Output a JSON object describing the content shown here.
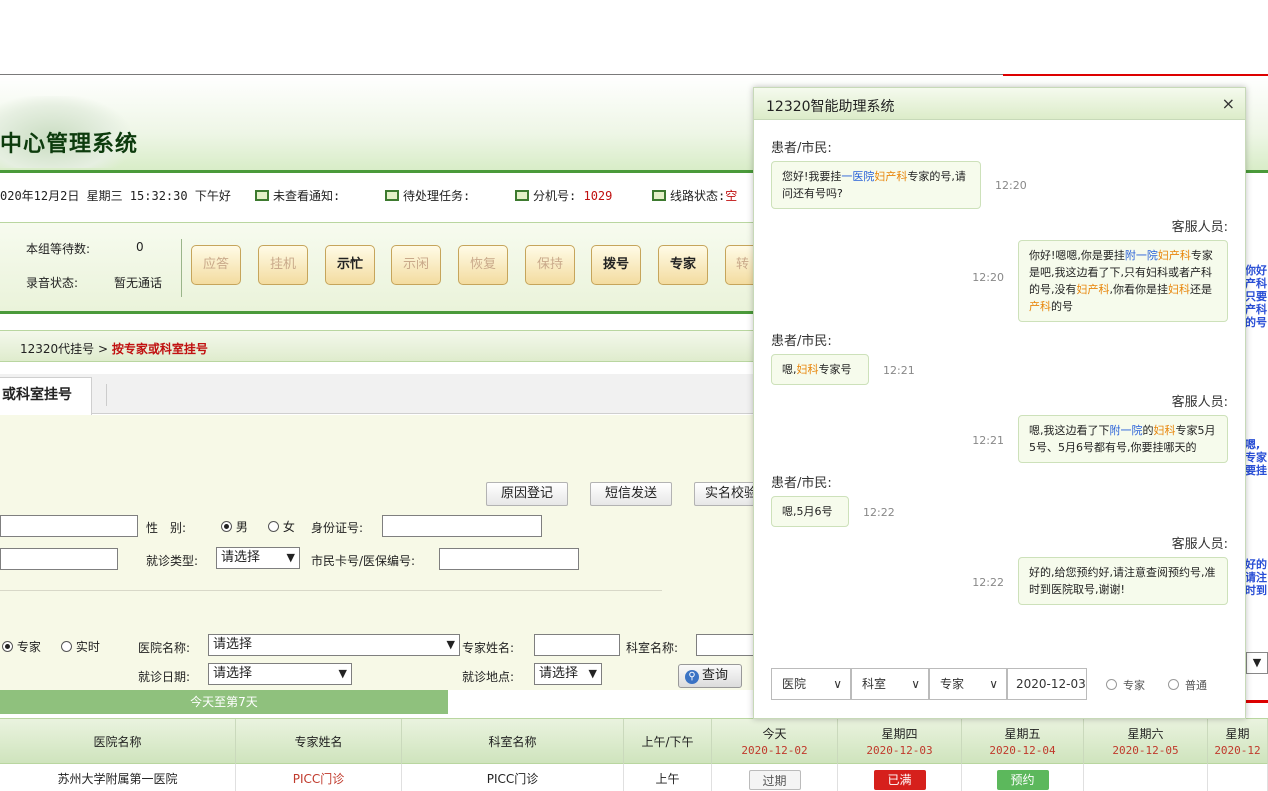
{
  "app": {
    "system_title": "中心管理系统"
  },
  "status_bar": {
    "datetime": "020年12月2日 星期三 15:32:30 下午好",
    "unread_notice": "未查看通知:",
    "pending_tasks": "待处理任务:",
    "extension_label": "分机号:",
    "extension_value": "1029",
    "line_status_label": "线路状态:",
    "line_status_value": "空"
  },
  "toolbar": {
    "queue_label": "本组等待数:",
    "queue_value": "0",
    "recording_label": "录音状态:",
    "recording_value": "暂无通话",
    "buttons": [
      {
        "label": "应答",
        "enabled": false
      },
      {
        "label": "挂机",
        "enabled": false
      },
      {
        "label": "示忙",
        "enabled": true
      },
      {
        "label": "示闲",
        "enabled": false
      },
      {
        "label": "恢复",
        "enabled": false
      },
      {
        "label": "保持",
        "enabled": false
      },
      {
        "label": "拨号",
        "enabled": true
      },
      {
        "label": "专家",
        "enabled": true
      },
      {
        "label": "转",
        "enabled": false
      }
    ]
  },
  "breadcrumb": {
    "parent": "12320代挂号",
    "separator": ">",
    "current": "按专家或科室挂号"
  },
  "tab": {
    "active_label": "或科室挂号"
  },
  "form": {
    "btn_reason": "原因登记",
    "btn_sms": "短信发送",
    "btn_realname": "实名校验",
    "gender_label": "性　别:",
    "gender_male": "男",
    "gender_female": "女",
    "id_label": "身份证号:",
    "visit_type_label": "就诊类型:",
    "visit_type_value": "请选择",
    "card_label": "市民卡号/医保编号:",
    "mode_expert": "专家",
    "mode_realtime": "实时",
    "hospital_label": "医院名称:",
    "hospital_value": "请选择",
    "expert_label": "专家姓名:",
    "dept_label": "科室名称:",
    "date_label": "就诊日期:",
    "date_value": "请选择",
    "place_label": "就诊地点:",
    "place_value": "请选择",
    "query_label": "查询",
    "range_label": "今天至第7天"
  },
  "table": {
    "headers": [
      {
        "l1": "医院名称",
        "l2": ""
      },
      {
        "l1": "专家姓名",
        "l2": ""
      },
      {
        "l1": "科室名称",
        "l2": ""
      },
      {
        "l1": "上午/下午",
        "l2": ""
      },
      {
        "l1": "今天",
        "l2": "2020-12-02"
      },
      {
        "l1": "星期四",
        "l2": "2020-12-03"
      },
      {
        "l1": "星期五",
        "l2": "2020-12-04"
      },
      {
        "l1": "星期六",
        "l2": "2020-12-05"
      },
      {
        "l1": "星期",
        "l2": "2020-12"
      }
    ],
    "row": {
      "hospital": "苏州大学附属第一医院",
      "expert": "PICC门诊",
      "dept": "PICC门诊",
      "period": "上午",
      "today": "过期",
      "thu": "已满",
      "fri": "预约"
    }
  },
  "right_fragments": {
    "block1": [
      "你好",
      "产科",
      "只要",
      "产科",
      "的号"
    ],
    "block2": [
      "嗯,",
      "专家",
      "要挂"
    ],
    "block3": [
      "好的",
      "请注",
      "时到"
    ]
  },
  "dialog": {
    "title": "12320智能助理系统",
    "close": "×",
    "messages": [
      {
        "sender": "患者/市民:",
        "side": "left",
        "time": "12:20",
        "parts": [
          [
            "您好!我要挂",
            ""
          ],
          [
            "一医院",
            "blue"
          ],
          [
            "妇产科",
            "orange"
          ],
          [
            "专家的号,请问还有号吗?",
            ""
          ]
        ]
      },
      {
        "sender": "客服人员:",
        "side": "right",
        "time": "12:20",
        "parts": [
          [
            "你好!嗯嗯,你是要挂",
            ""
          ],
          [
            "附一院",
            "blue"
          ],
          [
            "妇产科",
            "orange"
          ],
          [
            "专家是吧,我这边看了下,只有妇科或者产科的号,没有",
            ""
          ],
          [
            "妇产科",
            "orange"
          ],
          [
            ",你看你是挂",
            ""
          ],
          [
            "妇科",
            "orange"
          ],
          [
            "还是",
            ""
          ],
          [
            "产科",
            "orange"
          ],
          [
            "的号",
            ""
          ]
        ]
      },
      {
        "sender": "患者/市民:",
        "side": "left",
        "time": "12:21",
        "parts": [
          [
            "嗯,",
            ""
          ],
          [
            "妇科",
            "orange"
          ],
          [
            "专家号",
            ""
          ]
        ]
      },
      {
        "sender": "客服人员:",
        "side": "right",
        "time": "12:21",
        "parts": [
          [
            "嗯,我这边看了下",
            ""
          ],
          [
            "附一院",
            "blue"
          ],
          [
            "的",
            ""
          ],
          [
            "妇科",
            "orange"
          ],
          [
            "专家5月5号、5月6号都有号,你要挂哪天的",
            ""
          ]
        ]
      },
      {
        "sender": "患者/市民:",
        "side": "left",
        "time": "12:22",
        "parts": [
          [
            "嗯,5月6号",
            ""
          ]
        ]
      },
      {
        "sender": "客服人员:",
        "side": "right",
        "time": "12:22",
        "parts": [
          [
            "好的,给您预约好,请注意查阅预约号,准时到医院取号,谢谢!",
            ""
          ]
        ]
      }
    ],
    "footer": {
      "hospital": "医院",
      "dept": "科室",
      "expert": "专家",
      "date": "2020-12-03",
      "radio_expert": "专家",
      "radio_normal": "普通"
    }
  },
  "colors": {
    "accent_green": "#4a9a3a",
    "highlight_blue": "#2a62d8",
    "highlight_orange": "#e8850a",
    "status_full": "#d6201c",
    "status_book": "#5cb85c"
  }
}
